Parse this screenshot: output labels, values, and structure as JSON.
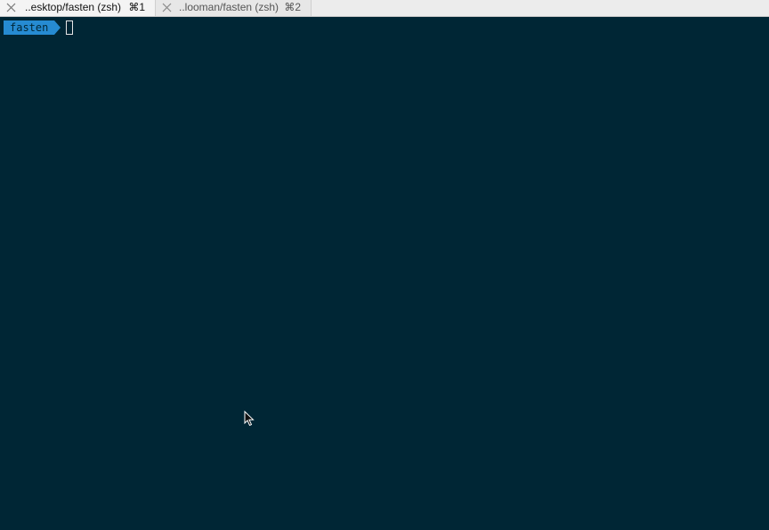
{
  "tabs": [
    {
      "title": "..esktop/fasten (zsh)",
      "shortcut": "⌘1",
      "active": true
    },
    {
      "title": "..looman/fasten (zsh)",
      "shortcut": "⌘2",
      "active": false
    }
  ],
  "terminal": {
    "prompt_dir": "fasten",
    "prompt_color": "#268bd2",
    "background": "#002635"
  },
  "icons": {
    "tab_close": "close-icon",
    "pointer": "mouse-pointer-icon"
  }
}
